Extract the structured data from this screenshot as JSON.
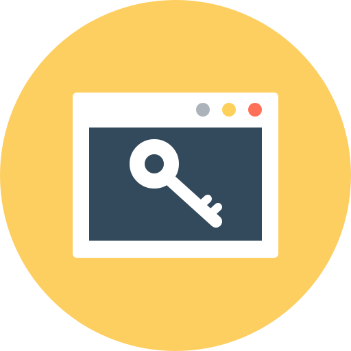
{
  "icon": {
    "name": "key-browser-window-icon",
    "colors": {
      "badge": "#FDCE60",
      "window": "#FFFFFF",
      "viewport": "#33495C",
      "key": "#FFFFFF",
      "dot_grey": "#ACB3BA",
      "dot_yellow": "#FCD05B",
      "dot_red": "#FF7058"
    }
  },
  "window": {
    "controls": [
      "minimize",
      "maximize",
      "close"
    ]
  }
}
